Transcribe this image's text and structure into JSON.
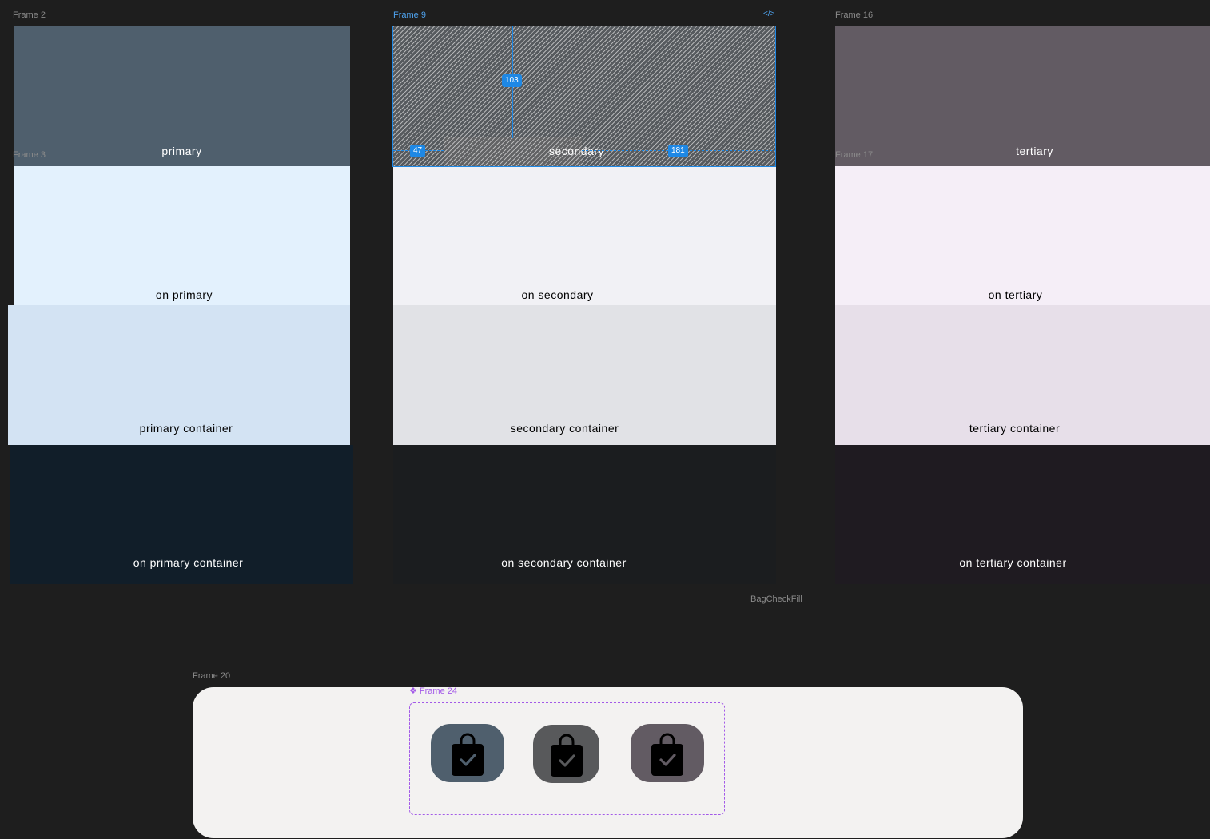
{
  "frames": {
    "frame2": "Frame 2",
    "frame3": "Frame 3",
    "frame9": "Frame 9",
    "frame16": "Frame 16",
    "frame17": "Frame 17",
    "frame20": "Frame 20",
    "frame24": "Frame 24",
    "component_name": "BagCheckFill"
  },
  "selection": {
    "code_icon": "</>",
    "distance_top": "103",
    "distance_left": "47",
    "distance_right": "181"
  },
  "columns": {
    "primary": {
      "swatches": [
        {
          "label": "primary",
          "bg": "#4f5f6d",
          "fg": "#ffffff"
        },
        {
          "label": "on primary",
          "bg": "#e3f1fd",
          "fg": "#000000"
        },
        {
          "label": "primary container",
          "bg": "#d3e3f3",
          "fg": "#000000"
        },
        {
          "label": "on primary container",
          "bg": "#111e29",
          "fg": "#ffffff"
        }
      ]
    },
    "secondary": {
      "swatches": [
        {
          "label": "secondary",
          "bg": "#565a5e",
          "fg": "#ffffff"
        },
        {
          "label": "on secondary",
          "bg": "#f1f1f5",
          "fg": "#000000"
        },
        {
          "label": "secondary container",
          "bg": "#e1e2e6",
          "fg": "#000000"
        },
        {
          "label": "on secondary container",
          "bg": "#1b1d1f",
          "fg": "#ffffff"
        }
      ]
    },
    "tertiary": {
      "swatches": [
        {
          "label": "tertiary",
          "bg": "#625b63",
          "fg": "#ffffff"
        },
        {
          "label": "on tertiary",
          "bg": "#f5eef7",
          "fg": "#000000"
        },
        {
          "label": "tertiary container",
          "bg": "#e7dfe9",
          "fg": "#000000"
        },
        {
          "label": "on tertiary container",
          "bg": "#1f1b21",
          "fg": "#ffffff"
        }
      ]
    }
  },
  "icons": [
    {
      "name": "bag-check-fill-icon",
      "bg": "#4f5f6d"
    },
    {
      "name": "bag-check-fill-icon",
      "bg": "#58595b"
    },
    {
      "name": "bag-check-fill-icon",
      "bg": "#625b63"
    }
  ],
  "colors": {
    "canvas": "#1e1e1e",
    "selection": "#1e88e5",
    "component": "#a35ae8",
    "panel": "#f3f2f1"
  }
}
